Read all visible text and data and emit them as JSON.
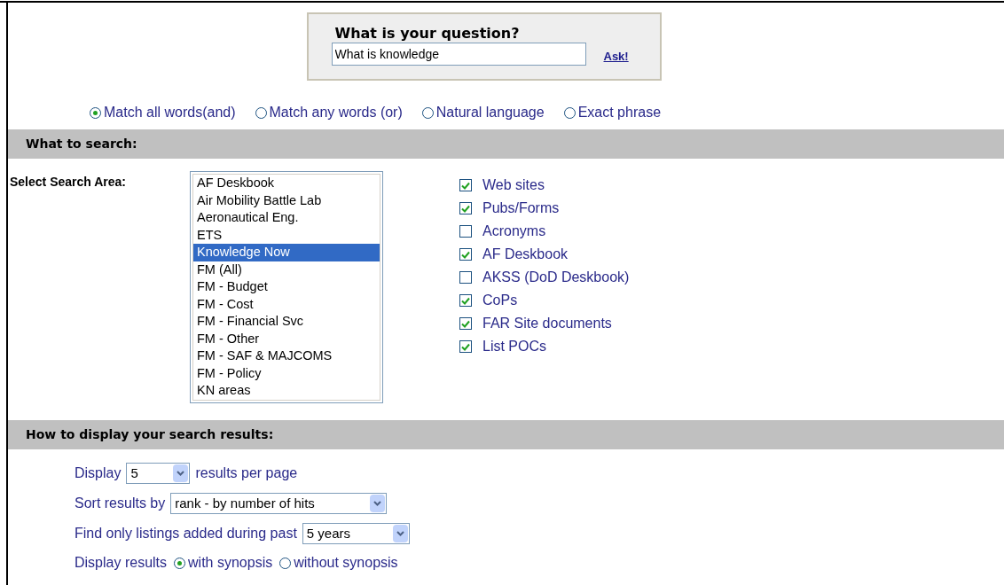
{
  "question": {
    "title": "What is your question?",
    "value": "What is knowledge",
    "ask": "Ask!"
  },
  "match_modes": [
    {
      "label": "Match all words(and)",
      "selected": true
    },
    {
      "label": "Match any words (or)",
      "selected": false
    },
    {
      "label": "Natural language",
      "selected": false
    },
    {
      "label": "Exact phrase",
      "selected": false
    }
  ],
  "search_section": {
    "title": "What to search:",
    "area_label": "Select Search Area:",
    "areas": [
      {
        "label": "AF Deskbook",
        "selected": false
      },
      {
        "label": "Air Mobility Battle Lab",
        "selected": false
      },
      {
        "label": "Aeronautical Eng.",
        "selected": false
      },
      {
        "label": "ETS",
        "selected": false
      },
      {
        "label": "Knowledge Now",
        "selected": true
      },
      {
        "label": "FM (All)",
        "selected": false
      },
      {
        "label": "FM - Budget",
        "selected": false
      },
      {
        "label": "FM - Cost",
        "selected": false
      },
      {
        "label": "FM - Financial Svc",
        "selected": false
      },
      {
        "label": "FM - Other",
        "selected": false
      },
      {
        "label": "FM - SAF & MAJCOMS",
        "selected": false
      },
      {
        "label": "FM - Policy",
        "selected": false
      },
      {
        "label": "KN areas",
        "selected": false
      }
    ],
    "sources": [
      {
        "label": "Web sites",
        "checked": true
      },
      {
        "label": "Pubs/Forms",
        "checked": true
      },
      {
        "label": "Acronyms",
        "checked": false
      },
      {
        "label": "AF Deskbook",
        "checked": true
      },
      {
        "label": "AKSS (DoD Deskbook)",
        "checked": false
      },
      {
        "label": "CoPs",
        "checked": true
      },
      {
        "label": "FAR Site documents",
        "checked": true
      },
      {
        "label": "List POCs",
        "checked": true
      }
    ]
  },
  "display_section": {
    "title": "How to display your search results:",
    "per_page": {
      "before": "Display",
      "value": "5",
      "after": "results per page"
    },
    "sort": {
      "label": "Sort results by",
      "value": "rank - by number of hits"
    },
    "period": {
      "label": "Find only listings added during past",
      "value": "5 years"
    },
    "synopsis": {
      "label": "Display results",
      "options": [
        {
          "label": "with synopsis",
          "selected": true
        },
        {
          "label": "without synopsis",
          "selected": false
        }
      ]
    }
  }
}
